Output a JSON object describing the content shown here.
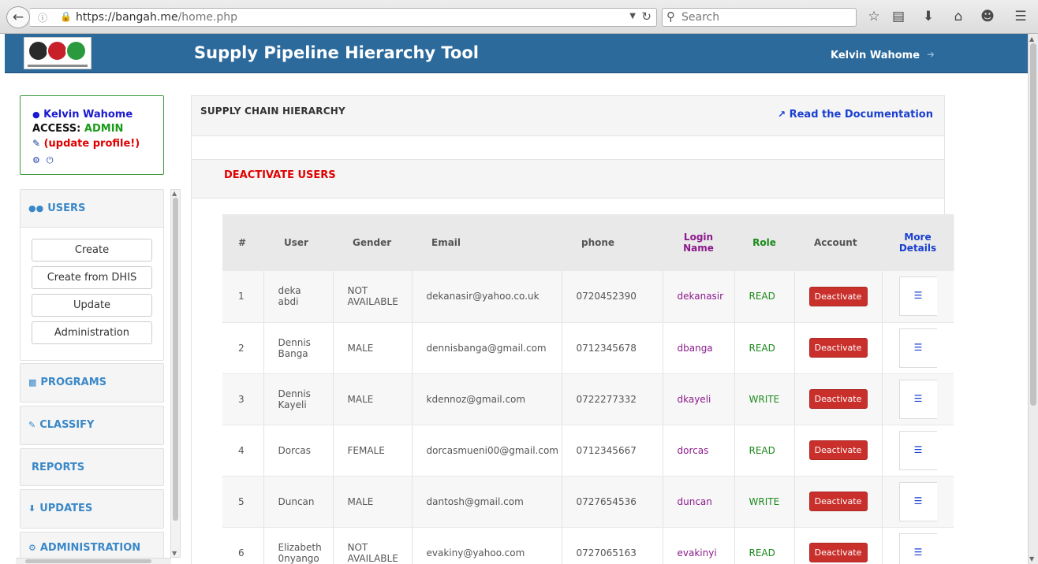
{
  "browser": {
    "url_host": "https://bangah.me",
    "url_path": "/home.php",
    "search_placeholder": "Search"
  },
  "header": {
    "title": "Supply Pipeline Hierarchy Tool",
    "user": "Kelvin Wahome"
  },
  "profile": {
    "name": "Kelvin Wahome",
    "access_label": "ACCESS:",
    "access_value": "ADMIN",
    "update_link": "(update profile!)"
  },
  "sidebar": {
    "users": {
      "label": "USERS",
      "items": [
        "Create",
        "Create from DHIS",
        "Update",
        "Administration"
      ]
    },
    "programs": "PROGRAMS",
    "classify": "CLASSIFY",
    "reports": "REPORTS",
    "updates": "UPDATES",
    "administration": "ADMINISTRATION"
  },
  "main": {
    "title": "SUPPLY CHAIN HIERARCHY",
    "doc_link": "Read the Documentation",
    "section_title": "DEACTIVATE USERS"
  },
  "table": {
    "headers": {
      "num": "#",
      "user": "User",
      "gender": "Gender",
      "email": "Email",
      "phone": "phone",
      "login_1": "Login",
      "login_2": "Name",
      "role": "Role",
      "account": "Account",
      "more_1": "More",
      "more_2": "Details"
    },
    "action_label": "Deactivate",
    "rows": [
      {
        "num": "1",
        "user_1": "deka",
        "user_2": "abdi",
        "gender_1": "NOT",
        "gender_2": "AVAILABLE",
        "email": "dekanasir@yahoo.co.uk",
        "phone": "0720452390",
        "login": "dekanasir",
        "role": "READ"
      },
      {
        "num": "2",
        "user_1": "Dennis",
        "user_2": "Banga",
        "gender_1": "MALE",
        "gender_2": "",
        "email": "dennisbanga@gmail.com",
        "phone": "0712345678",
        "login": "dbanga",
        "role": "READ"
      },
      {
        "num": "3",
        "user_1": "Dennis",
        "user_2": "Kayeli",
        "gender_1": "MALE",
        "gender_2": "",
        "email": "kdennoz@gmail.com",
        "phone": "0722277332",
        "login": "dkayeli",
        "role": "WRITE"
      },
      {
        "num": "4",
        "user_1": "Dorcas",
        "user_2": "",
        "gender_1": "FEMALE",
        "gender_2": "",
        "email": "dorcasmueni00@gmail.com",
        "phone": "0712345667",
        "login": "dorcas",
        "role": "READ"
      },
      {
        "num": "5",
        "user_1": "Duncan",
        "user_2": "",
        "gender_1": "MALE",
        "gender_2": "",
        "email": "dantosh@gmail.com",
        "phone": "0727654536",
        "login": "duncan",
        "role": "WRITE"
      },
      {
        "num": "6",
        "user_1": "Elizabeth",
        "user_2": "0nyango",
        "gender_1": "NOT",
        "gender_2": "AVAILABLE",
        "email": "evakiny@yahoo.com",
        "phone": "0727065163",
        "login": "evakinyi",
        "role": "READ"
      }
    ]
  }
}
